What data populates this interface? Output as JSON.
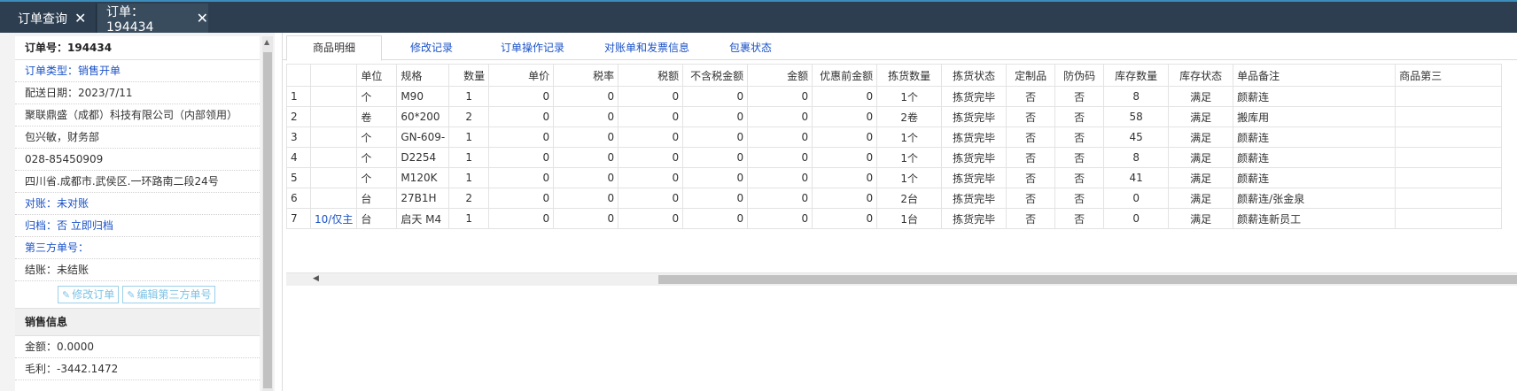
{
  "tabs": [
    {
      "label": "订单查询"
    },
    {
      "label": "订单：194434"
    }
  ],
  "order": {
    "order_no": "订单号：194434",
    "order_type": "订单类型：销售开单",
    "delivery_date": "配送日期：2023/7/11",
    "company": "聚联鼎盛（成都）科技有限公司（内部领用）",
    "contact": "包兴敏，财务部",
    "phone": "028-85450909",
    "address": "四川省.成都市.武侯区.一环路南二段24号",
    "reconcile": "对账：未对账",
    "archive": "归档：否 立即归档",
    "third_party": "第三方单号：",
    "settle": "结账：未结账",
    "edit_order_btn": "修改订单",
    "edit_third_btn": "编辑第三方单号"
  },
  "sales": {
    "heading": "销售信息",
    "amount": "金额：0.0000",
    "profit": "毛利：-3442.1472"
  },
  "subtabs": [
    "商品明细",
    "修改记录",
    "订单操作记录",
    "对账单和发票信息",
    "包裹状态"
  ],
  "table": {
    "headers": [
      "",
      "",
      "单位",
      "规格",
      "数量",
      "单价",
      "税率",
      "税额",
      "不含税金额",
      "金额",
      "优惠前金额",
      "拣货数量",
      "拣货状态",
      "定制品",
      "防伪码",
      "库存数量",
      "库存状态",
      "单品备注",
      "商品第三"
    ],
    "rows": [
      [
        "1",
        "",
        "个",
        "M90",
        "1",
        "0",
        "0",
        "0",
        "0",
        "0",
        "0",
        "1个",
        "拣货完毕",
        "否",
        "否",
        "8",
        "满足",
        "颜薪连",
        ""
      ],
      [
        "2",
        "",
        "卷",
        "60*200",
        "2",
        "0",
        "0",
        "0",
        "0",
        "0",
        "0",
        "2卷",
        "拣货完毕",
        "否",
        "否",
        "58",
        "满足",
        "搬库用",
        ""
      ],
      [
        "3",
        "",
        "个",
        "GN-609-",
        "1",
        "0",
        "0",
        "0",
        "0",
        "0",
        "0",
        "1个",
        "拣货完毕",
        "否",
        "否",
        "45",
        "满足",
        "颜薪连",
        ""
      ],
      [
        "4",
        "",
        "个",
        "D2254",
        "1",
        "0",
        "0",
        "0",
        "0",
        "0",
        "0",
        "1个",
        "拣货完毕",
        "否",
        "否",
        "8",
        "满足",
        "颜薪连",
        ""
      ],
      [
        "5",
        "",
        "个",
        "M120K",
        "1",
        "0",
        "0",
        "0",
        "0",
        "0",
        "0",
        "1个",
        "拣货完毕",
        "否",
        "否",
        "41",
        "满足",
        "颜薪连",
        ""
      ],
      [
        "6",
        "",
        "台",
        "27B1H",
        "2",
        "0",
        "0",
        "0",
        "0",
        "0",
        "0",
        "2台",
        "拣货完毕",
        "否",
        "否",
        "0",
        "满足",
        "颜薪连/张金泉",
        ""
      ],
      [
        "7",
        "10/仅主",
        "台",
        "启天 M4",
        "1",
        "0",
        "0",
        "0",
        "0",
        "0",
        "0",
        "1台",
        "拣货完毕",
        "否",
        "否",
        "0",
        "满足",
        "颜薪连新员工",
        ""
      ]
    ]
  },
  "colors": {
    "accent": "#1a52c8",
    "topbar": "#2c3e50",
    "button": "#7cc3e6"
  }
}
